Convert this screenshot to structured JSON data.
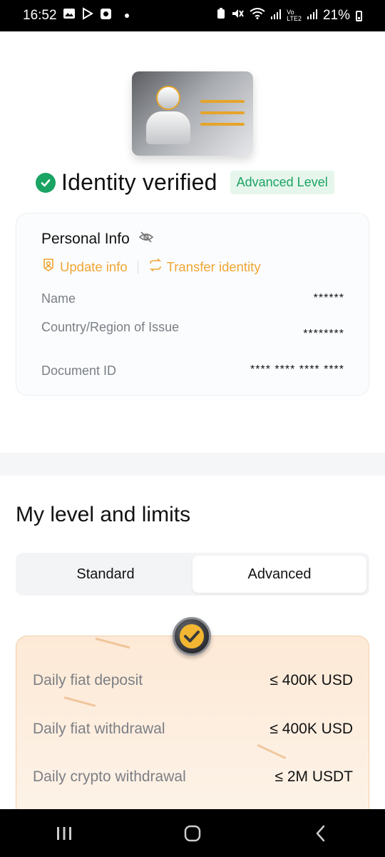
{
  "status_bar": {
    "time": "16:52",
    "battery": "21%",
    "icons": [
      "gallery-icon",
      "play-store-icon",
      "app-icon",
      "dot-icon",
      "battery-saver-icon",
      "mute-icon",
      "wifi-icon",
      "signal-icon",
      "volte-icon",
      "signal-icon-2",
      "battery-icon"
    ]
  },
  "verification": {
    "title": "Identity verified",
    "level_badge": "Advanced Level",
    "status_color": "#1aa463"
  },
  "personal_info": {
    "title": "Personal Info",
    "update_label": "Update info",
    "transfer_label": "Transfer identity",
    "accent": "#f0a632",
    "rows": [
      {
        "label": "Name",
        "value": "******"
      },
      {
        "label": "Country/Region of Issue",
        "value": "********"
      },
      {
        "label": "Document ID",
        "value": "**** **** **** ****"
      }
    ]
  },
  "limits": {
    "title": "My level and limits",
    "tabs": [
      {
        "label": "Standard",
        "active": false
      },
      {
        "label": "Advanced",
        "active": true
      }
    ],
    "rows": [
      {
        "label": "Daily fiat deposit",
        "value": "≤ 400K USD"
      },
      {
        "label": "Daily fiat withdrawal",
        "value": "≤ 400K USD"
      },
      {
        "label": "Daily crypto withdrawal",
        "value": "≤ 2M USDT"
      }
    ]
  },
  "nav": {
    "buttons": [
      "recent-apps-icon",
      "home-icon",
      "back-icon"
    ]
  }
}
